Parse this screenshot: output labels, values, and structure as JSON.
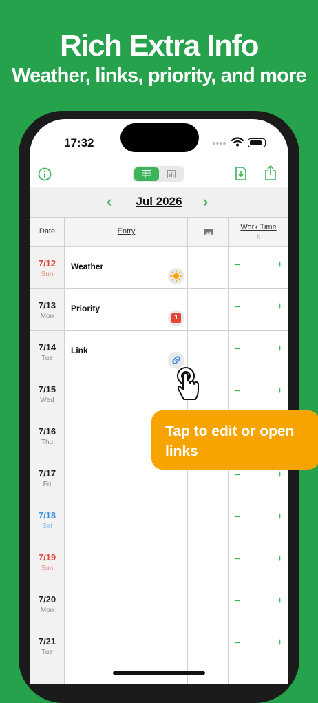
{
  "promo": {
    "title": "Rich Extra Info",
    "subtitle": "Weather, links, priority, and more"
  },
  "status_bar": {
    "time": "17:32"
  },
  "calendar": {
    "month": "Jul 2026",
    "columns": {
      "date": "Date",
      "entry": "Entry",
      "work_time": "Work Time",
      "work_unit": "h"
    },
    "rows": [
      {
        "date": "7/12",
        "day": "Sun",
        "entry": "Weather",
        "badge": "sun-icon"
      },
      {
        "date": "7/13",
        "day": "Mon",
        "entry": "Priority",
        "badge": "priority-1",
        "badge_text": "1"
      },
      {
        "date": "7/14",
        "day": "Tue",
        "entry": "Link",
        "badge": "link-icon"
      },
      {
        "date": "7/15",
        "day": "Wed",
        "entry": ""
      },
      {
        "date": "7/16",
        "day": "Thu",
        "entry": ""
      },
      {
        "date": "7/17",
        "day": "Fri",
        "entry": ""
      },
      {
        "date": "7/18",
        "day": "Sat",
        "entry": ""
      },
      {
        "date": "7/19",
        "day": "Sun",
        "entry": ""
      },
      {
        "date": "7/20",
        "day": "Mon",
        "entry": ""
      },
      {
        "date": "7/21",
        "day": "Tue",
        "entry": ""
      }
    ],
    "stepper": {
      "minus": "−",
      "plus": "+"
    }
  },
  "tooltip": {
    "text": "Tap to edit or open links"
  },
  "colors": {
    "accent": "#3db35a",
    "background": "#25a24b",
    "tooltip": "#f7a300",
    "sunday": "#e0453a",
    "saturday": "#3a8ee0"
  }
}
